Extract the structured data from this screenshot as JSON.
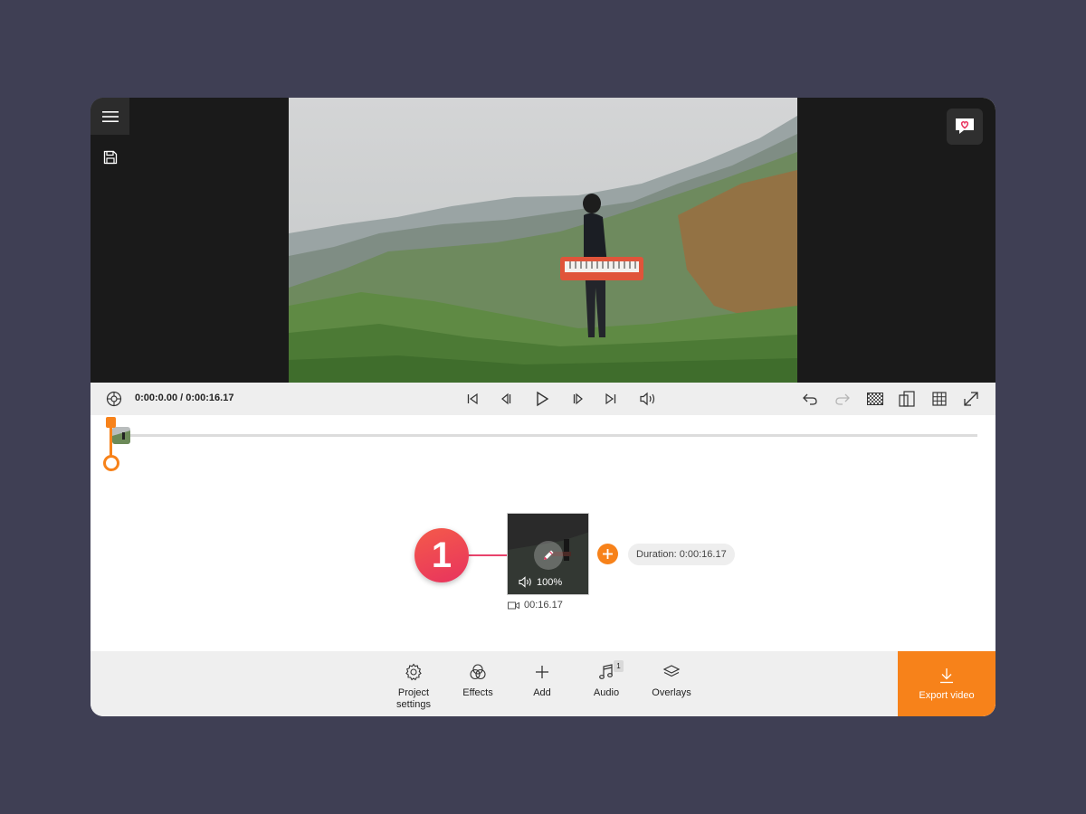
{
  "playback": {
    "time_readout": "0:00:0.00 / 0:00:16.17"
  },
  "storyboard": {
    "clip_volume": "100%",
    "clip_duration": "00:16.17",
    "duration_pill": "Duration: 0:00:16.17"
  },
  "tutorial": {
    "step_number": "1"
  },
  "toolbar": {
    "project_settings_label": "Project settings",
    "effects_label": "Effects",
    "add_label": "Add",
    "audio_label": "Audio",
    "audio_badge": "1",
    "overlays_label": "Overlays",
    "export_label": "Export video"
  },
  "colors": {
    "accent": "#f7821a",
    "step_badge": "#e8335e",
    "preview_bg": "#1a1a1a",
    "page_bg": "#3f3f54"
  },
  "icons": [
    "hamburger-icon",
    "save-icon",
    "heart-chat-icon",
    "settings-wheel-icon",
    "skip-start-icon",
    "step-back-icon",
    "play-icon",
    "step-forward-icon",
    "skip-end-icon",
    "volume-icon",
    "undo-icon",
    "redo-icon",
    "checker-icon",
    "aspect-icon",
    "grid-icon",
    "fullscreen-icon",
    "pencil-icon",
    "plus-icon",
    "camera-icon",
    "gear-icon",
    "effects-icon",
    "music-icon",
    "layers-icon",
    "download-icon"
  ]
}
